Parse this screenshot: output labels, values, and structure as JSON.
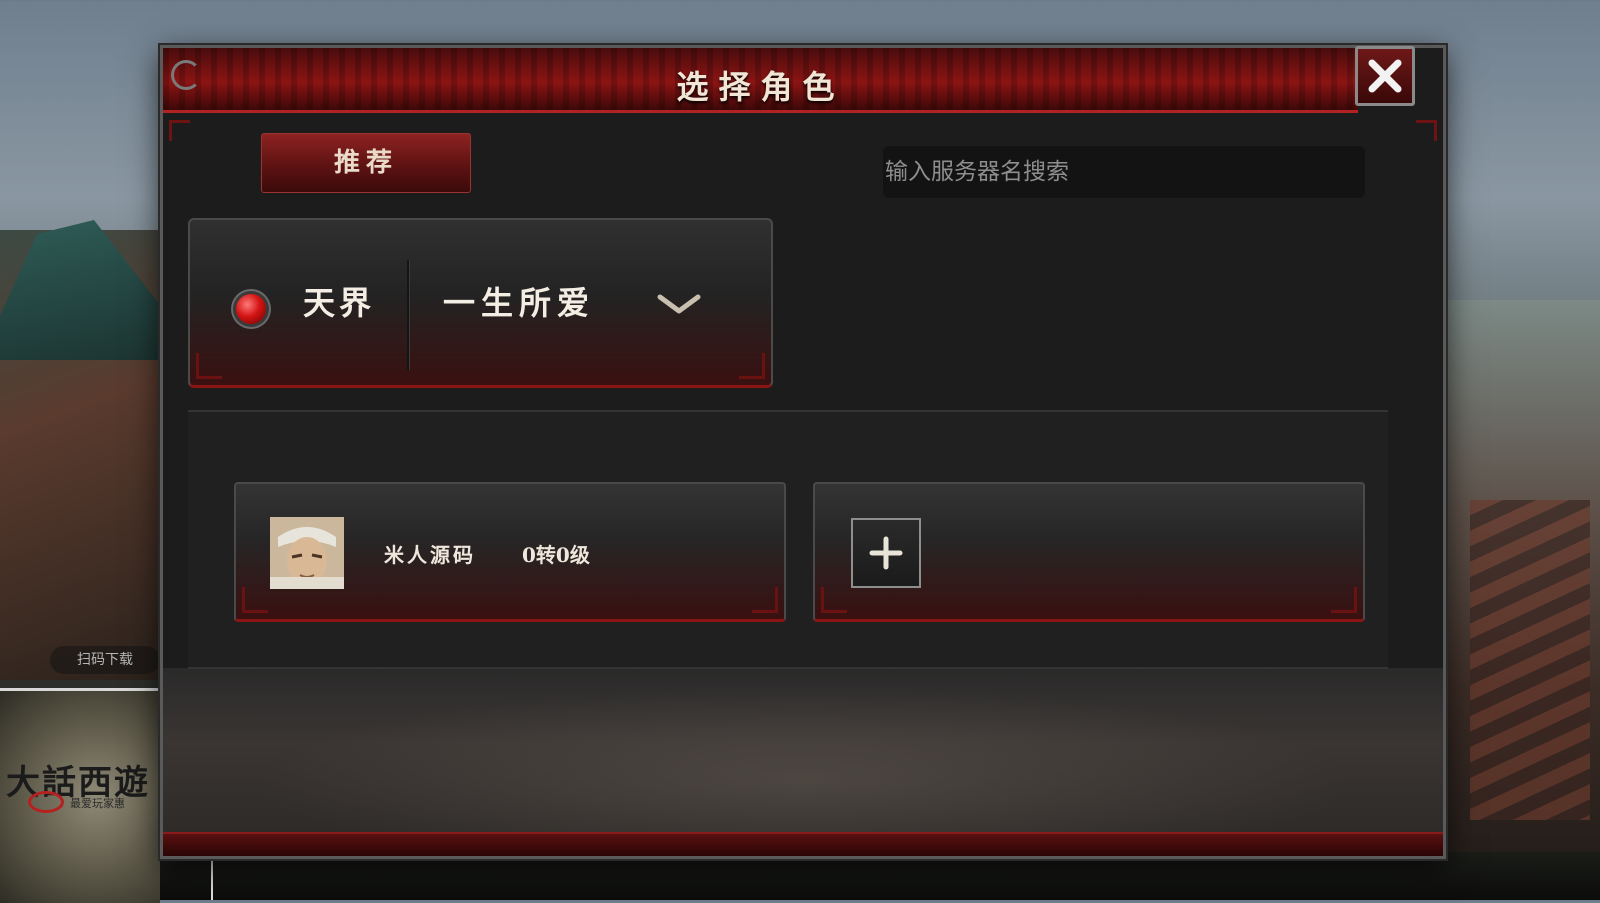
{
  "dialog": {
    "title": "选择角色",
    "close_icon": "close-x-icon"
  },
  "tabs": [
    {
      "label": "推荐",
      "active": true
    }
  ],
  "search": {
    "placeholder": "输入服务器名搜索",
    "value": ""
  },
  "server": {
    "zone": "天界",
    "name": "一生所爱",
    "status_color": "#d41414",
    "dropdown_icon": "chevron-down-icon"
  },
  "characters": [
    {
      "name": "米人源码",
      "level": "0转0级",
      "avatar_icon": "character-portrait"
    }
  ],
  "add_slot": {
    "icon": "plus-icon"
  },
  "background": {
    "qr_label": "扫码下载",
    "logo_text": "大話西遊",
    "logo_subtitle": "最爱玩家惠"
  },
  "colors": {
    "accent_red": "#8c1414",
    "title_text": "#f1e6d6"
  }
}
